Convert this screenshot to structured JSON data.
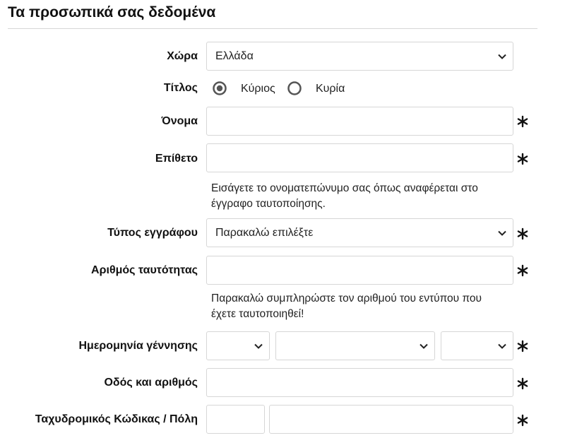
{
  "section": {
    "title": "Τα προσωπικά σας δεδομένα"
  },
  "country": {
    "label": "Χώρα",
    "value": "Ελλάδα"
  },
  "salutation": {
    "label": "Τίτλος",
    "options": [
      {
        "label": "Κύριος",
        "selected": true
      },
      {
        "label": "Κυρία",
        "selected": false
      }
    ]
  },
  "first_name": {
    "label": "Όνομα",
    "value": ""
  },
  "last_name": {
    "label": "Επίθετο",
    "value": ""
  },
  "name_hint": {
    "line1": "Εισάγετε το ονοματεπώνυμο σας όπως αναφέρεται στο",
    "line2": "έγγραφο ταυτοποίησης."
  },
  "document_type": {
    "label": "Τύπος εγγράφου",
    "value": "Παρακαλώ επιλέξτε"
  },
  "id_number": {
    "label": "Αριθμός ταυτότητας",
    "value": ""
  },
  "id_hint": {
    "line1": "Παρακαλώ συμπληρώστε τον αριθμού του εντύπου που",
    "line2": "έχετε ταυτοποιηθεί!"
  },
  "birth_date": {
    "label": "Ημερομηνία γέννησης",
    "day": "",
    "month": "",
    "year": ""
  },
  "street": {
    "label": "Οδός και αριθμός",
    "value": ""
  },
  "postal_city": {
    "label": "Ταχυδρομικός Κώδικας / Πόλη",
    "postal": "",
    "city": ""
  },
  "icons": {
    "dropdown": "chevron-down-icon",
    "required": "asterisk-icon",
    "radio": "radio-button-icon"
  },
  "colors": {
    "border": "#d6d6d6",
    "text": "#111111",
    "radio_ring": "#555555"
  }
}
